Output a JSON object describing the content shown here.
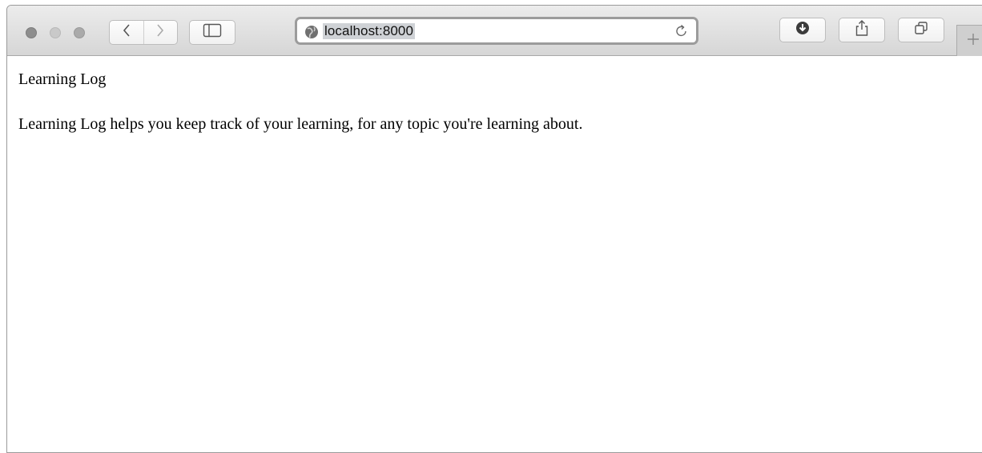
{
  "browser": {
    "url": "localhost:8000",
    "icons": {
      "close": "close-window-icon",
      "minimize": "minimize-window-icon",
      "maximize": "maximize-window-icon",
      "back": "chevron-left-icon",
      "forward": "chevron-right-icon",
      "sidebar": "sidebar-icon",
      "site": "globe-icon",
      "reload": "reload-icon",
      "downloads": "download-icon",
      "share": "share-icon",
      "tabs": "tab-overview-icon",
      "new_tab": "plus-icon"
    },
    "colors": {
      "toolbar_top": "#ececec",
      "toolbar_bottom": "#d6d6d6",
      "url_highlight": "#cfd2d6"
    }
  },
  "page": {
    "heading": "Learning Log",
    "description": "Learning Log helps you keep track of your learning, for any topic you're learning about."
  }
}
